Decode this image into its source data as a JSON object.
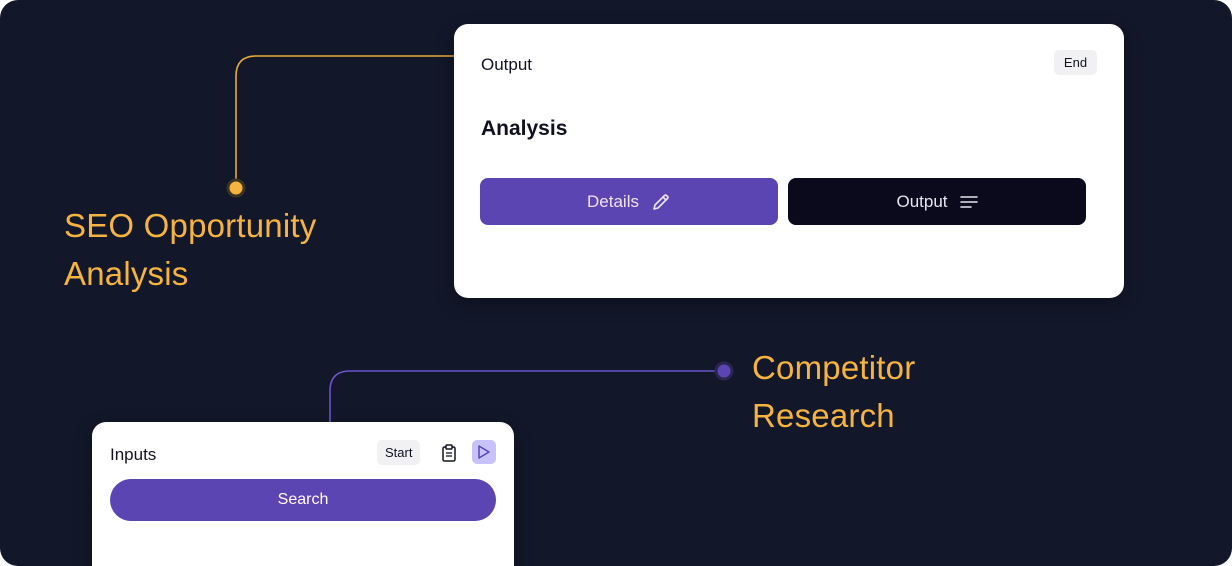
{
  "labels": {
    "seo": "SEO Opportunity Analysis",
    "competitor": "Competitor Research"
  },
  "output_node": {
    "title": "Output",
    "badge": "End",
    "heading": "Analysis",
    "details_button": "Details",
    "output_button": "Output"
  },
  "inputs_node": {
    "title": "Inputs",
    "badge": "Start",
    "search_button": "Search"
  },
  "colors": {
    "background": "#121729",
    "accent_orange": "#f6b43f",
    "accent_purple": "#5a45b3",
    "dark_button": "#0b0a1c"
  },
  "icons": [
    "pencil-icon",
    "lines-icon",
    "clipboard-icon",
    "play-icon"
  ]
}
